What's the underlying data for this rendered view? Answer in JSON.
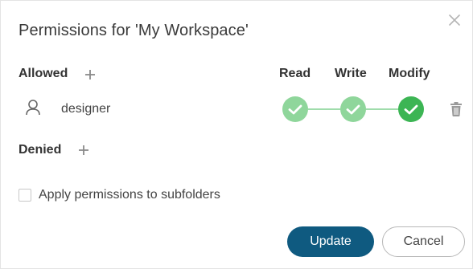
{
  "dialog": {
    "title": "Permissions for 'My Workspace'",
    "close_icon": "close-icon"
  },
  "allowed": {
    "label": "Allowed",
    "add_icon": "plus-icon"
  },
  "denied": {
    "label": "Denied",
    "add_icon": "plus-icon"
  },
  "columns": {
    "read": "Read",
    "write": "Write",
    "modify": "Modify"
  },
  "users": [
    {
      "icon": "user-icon",
      "name": "designer",
      "read": true,
      "write": true,
      "modify": true,
      "delete_icon": "trash-icon"
    }
  ],
  "options": {
    "apply_subfolders_label": "Apply permissions to subfolders",
    "apply_subfolders_checked": false
  },
  "buttons": {
    "update": "Update",
    "cancel": "Cancel"
  },
  "colors": {
    "primary": "#0f5a80",
    "perm_light": "#8fd69b",
    "perm_active": "#3cb554"
  }
}
